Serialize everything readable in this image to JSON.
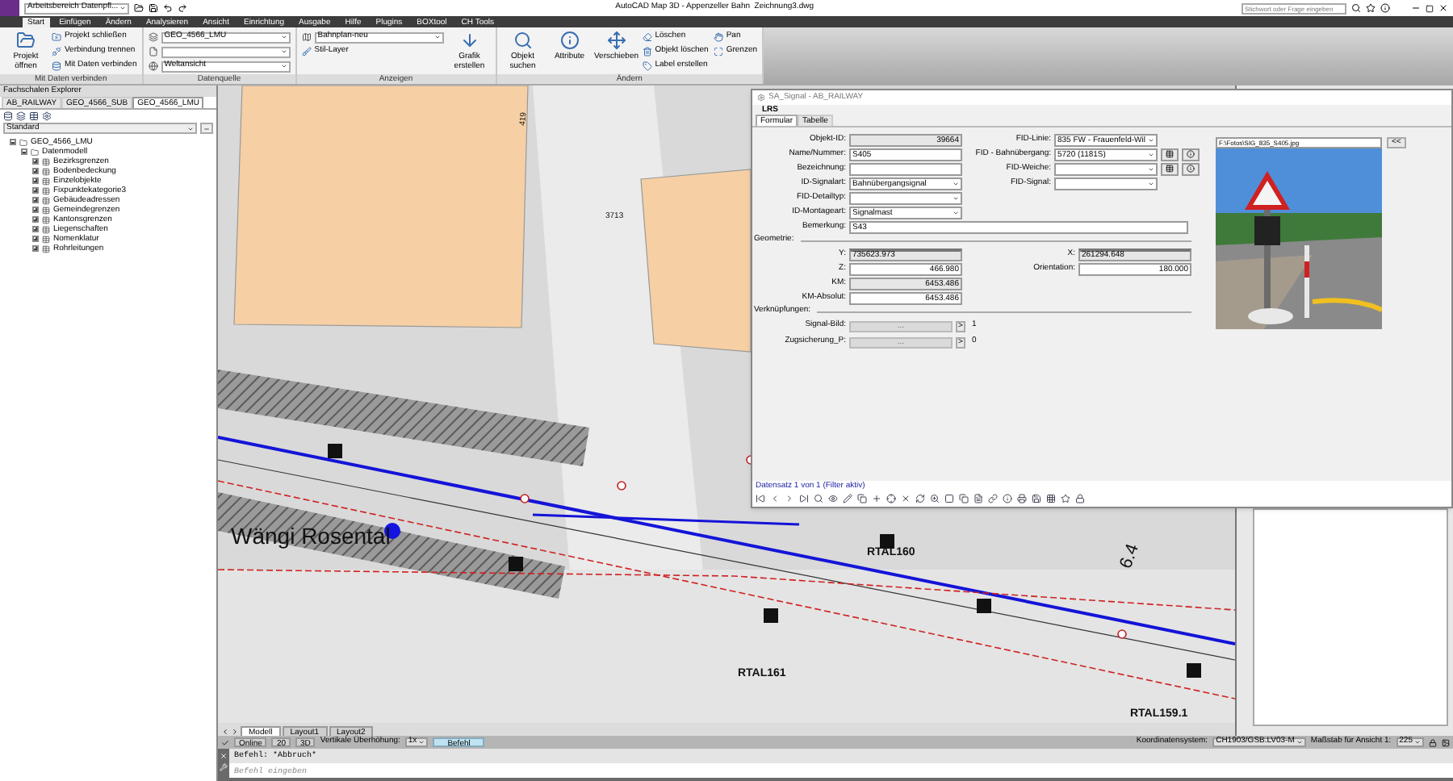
{
  "window": {
    "quick_access": "Arbeitsbereich Datenpfl...",
    "title": "AutoCAD Map 3D - Appenzeller Bahn  Zeichnung3.dwg",
    "search": {
      "placeholder": "Stichwort oder Frage eingeben"
    }
  },
  "ribbon_tabs": [
    {
      "label": "Start",
      "selected": true
    },
    {
      "label": "Einfügen",
      "selected": false
    },
    {
      "label": "Ändern",
      "selected": false
    },
    {
      "label": "Analysieren",
      "selected": false
    },
    {
      "label": "Ansicht",
      "selected": false
    },
    {
      "label": "Einrichtung",
      "selected": false
    },
    {
      "label": "Ausgabe",
      "selected": false
    },
    {
      "label": "Hilfe",
      "selected": false
    },
    {
      "label": "Plugins",
      "selected": false
    },
    {
      "label": "BOXtool",
      "selected": false
    },
    {
      "label": "CH Tools",
      "selected": false
    }
  ],
  "ribbon_panels": [
    {
      "label": "Mit Daten verbinden",
      "items": [
        {
          "kind": "large",
          "label": "Projekt öffnen"
        },
        {
          "kind": "small",
          "label": "Projekt schließen"
        },
        {
          "kind": "small",
          "label": "Verbindung trennen"
        },
        {
          "kind": "small",
          "label": "Mit Daten verbinden"
        }
      ]
    },
    {
      "label": "Datenquelle",
      "items": [
        {
          "kind": "dropdown",
          "value": "GEO_4566_LMU"
        },
        {
          "kind": "dropdown"
        },
        {
          "kind": "dropdown",
          "value": "Weltansicht"
        }
      ]
    },
    {
      "label": "Anzeigen",
      "items": [
        {
          "kind": "dropdown",
          "value": "Bahnplan-neu"
        },
        {
          "kind": "small",
          "label": "Stil-Layer"
        },
        {
          "kind": "large",
          "label": "Grafik erstellen"
        }
      ]
    },
    {
      "label": "Ändern",
      "items": [
        {
          "kind": "large",
          "label": "Objekt suchen"
        },
        {
          "kind": "large",
          "label": "Attribute"
        },
        {
          "kind": "large",
          "label": "Verschieben"
        },
        {
          "kind": "small",
          "label": "Löschen"
        },
        {
          "kind": "small",
          "label": "Objekt löschen"
        },
        {
          "kind": "small",
          "label": "Label erstellen"
        },
        {
          "kind": "small",
          "label": "Pan"
        },
        {
          "kind": "small",
          "label": "Grenzen"
        }
      ]
    }
  ],
  "explorer": {
    "title": "Fachschalen Explorer",
    "tabs": [
      {
        "label": "AB_RAILWAY",
        "selected": false
      },
      {
        "label": "GEO_4566_SUB",
        "selected": false
      },
      {
        "label": "GEO_4566_LMU",
        "selected": true
      }
    ],
    "filter": "Standard",
    "tree": [
      {
        "label": "GEO_4566_LMU",
        "expanded": true,
        "children": [
          {
            "label": "Datenmodell",
            "expanded": true,
            "children": [
              {
                "label": "Bezirksgrenzen",
                "expanded": false
              },
              {
                "label": "Bodenbedeckung",
                "expanded": false
              },
              {
                "label": "Einzelobjekte",
                "expanded": false
              },
              {
                "label": "Fixpunktekategorie3",
                "expanded": false
              },
              {
                "label": "Gebäudeadressen",
                "expanded": false
              },
              {
                "label": "Gemeindegrenzen",
                "expanded": false
              },
              {
                "label": "Kantonsgrenzen",
                "expanded": false
              },
              {
                "label": "Liegenschaften",
                "expanded": false
              },
              {
                "label": "Nomenklatur",
                "expanded": false
              },
              {
                "label": "Rohrleitungen",
                "expanded": false
              }
            ]
          }
        ]
      }
    ]
  },
  "map": {
    "labels": [
      {
        "text": "Wängi Rosental"
      },
      {
        "text": "RTAL160"
      },
      {
        "text": "RTAL161"
      },
      {
        "text": "RTAL159.1"
      },
      {
        "text": "6.4"
      },
      {
        "text": "3713"
      },
      {
        "text": "419"
      }
    ]
  },
  "dialog": {
    "title": "SA_Signal - AB_RAILWAY",
    "section": "LRS",
    "tabs": [
      {
        "label": "Formular",
        "selected": true
      },
      {
        "label": "Tabelle",
        "selected": false
      }
    ],
    "left_fields": [
      {
        "label": "Objekt-ID:",
        "kind": "readonly_number",
        "value": "39664"
      },
      {
        "label": "Name/Nummer:",
        "kind": "text",
        "value": "S405"
      },
      {
        "label": "Bezeichnung:",
        "kind": "text"
      },
      {
        "label": "ID-Signalart:",
        "kind": "select",
        "value": "Bahnübergangsignal"
      },
      {
        "label": "FID-Detailtyp:",
        "kind": "select"
      },
      {
        "label": "ID-Montageart:",
        "kind": "select",
        "value": "Signalmast"
      }
    ],
    "right_fields": [
      {
        "label": "FID-Linie:",
        "kind": "select",
        "value": "835 FW - Frauenfeld-Wil"
      },
      {
        "label": "FID - Bahnübergang:",
        "kind": "select_linked",
        "value": "5720 (1181S)"
      },
      {
        "label": "FID-Weiche:",
        "kind": "select_linked"
      },
      {
        "label": "FID-Signal:",
        "kind": "select"
      }
    ],
    "remark": {
      "label": "Bemerkung:",
      "value": "S43"
    },
    "geometry": {
      "heading": "Geometrie:",
      "left_fields": [
        {
          "label": "Y:",
          "kind": "coordinate",
          "value": "735623.973"
        },
        {
          "label": "Z:",
          "kind": "number",
          "value": "466.980"
        },
        {
          "label": "KM:",
          "kind": "readonly_number",
          "value": "6453.486"
        },
        {
          "label": "KM-Absolut:",
          "kind": "number",
          "value": "6453.486"
        }
      ],
      "right_fields": [
        {
          "label": "X:",
          "kind": "coordinate",
          "value": "261294.648"
        },
        {
          "label": "Orientation:",
          "kind": "number",
          "value": "180.000"
        }
      ]
    },
    "links": {
      "heading": "Verknüpfungen:",
      "items": [
        {
          "label": "Signal-Bild:",
          "button": "...",
          "nav": ">",
          "count": "1"
        },
        {
          "label": "Zugsicherung_P:",
          "button": "...",
          "nav": ">",
          "count": "0"
        }
      ]
    },
    "photo": {
      "path": "F:\\Fotos\\SIG_835_S405.jpg",
      "button": "<<",
      "kind": "picture"
    },
    "record_status": "Datensatz 1 von 1 (Filter aktiv)"
  },
  "layout_tabs": [
    {
      "label": "Modell",
      "selected": true
    },
    {
      "label": "Layout1",
      "selected": false
    },
    {
      "label": "Layout2",
      "selected": false
    }
  ],
  "status_bar": [
    {
      "kind": "toggle",
      "label": "Online"
    },
    {
      "kind": "toggle",
      "label": "20"
    },
    {
      "kind": "toggle",
      "label": "3D"
    },
    {
      "kind": "label",
      "label": "Vertikale Überhöhung:"
    },
    {
      "kind": "dropdown",
      "label": "1x"
    },
    {
      "kind": "button",
      "label": "Befehl"
    },
    {
      "kind": "spacer"
    },
    {
      "kind": "label",
      "label": "Koordinatensystem:"
    },
    {
      "kind": "dropdown",
      "label": "CH1903/GSB.LV03-M"
    },
    {
      "kind": "label",
      "label": "Maßstab für Ansicht 1:"
    },
    {
      "kind": "dropdown",
      "label": "225"
    }
  ],
  "command": {
    "history": "Befehl: *Abbruch*",
    "placeholder": "Befehl eingeben"
  }
}
